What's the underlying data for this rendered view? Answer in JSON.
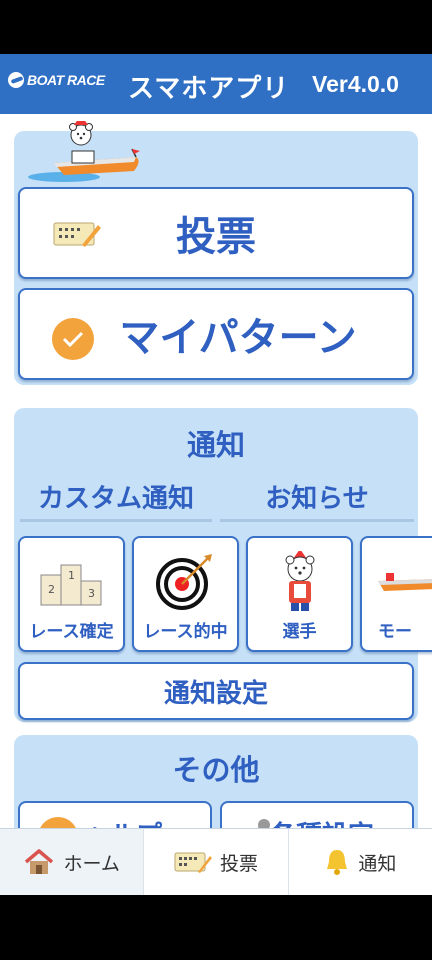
{
  "header": {
    "logo_text": "BOAT RACE",
    "app_title": "スマホアプリ",
    "version": "Ver4.0.0"
  },
  "main": {
    "vote_label": "投票",
    "mypattern_label": "マイパターン",
    "notify_section": {
      "title": "通知",
      "tabs": [
        "カスタム通知",
        "お知らせ"
      ],
      "tiles": [
        "レース確定",
        "レース的中",
        "選手",
        "モー"
      ],
      "settings_label": "通知設定"
    },
    "other_section": {
      "title": "その他",
      "buttons": [
        "ヘルプ",
        "各種設定"
      ]
    }
  },
  "bottom_nav": {
    "items": [
      {
        "label": "ホーム",
        "icon": "house-icon",
        "active": true
      },
      {
        "label": "投票",
        "icon": "ticket-icon",
        "active": false
      },
      {
        "label": "通知",
        "icon": "bell-icon",
        "active": false
      }
    ]
  },
  "colors": {
    "header": "#2f6fc4",
    "card": "#c6e0f7",
    "accent_text": "#2f5fc0",
    "check_orange": "#f2a33c"
  }
}
